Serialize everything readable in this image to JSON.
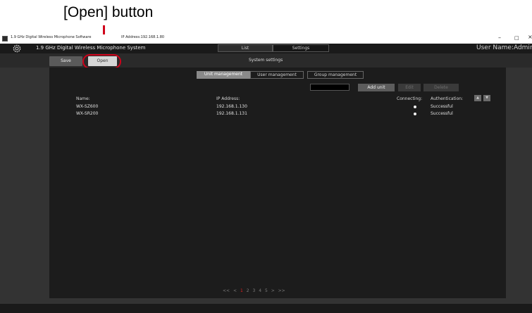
{
  "annotation": {
    "label": "[Open] button"
  },
  "window": {
    "title": "1.9 GHz Digital Wireless Microphone Software",
    "ip": "IP Address:192.168.1.80",
    "minimize": "–",
    "maximize": "□",
    "close": "×"
  },
  "header": {
    "system_name": "1.9 GHz Digital Wireless Microphone System",
    "tabs": [
      "List",
      "Settings"
    ],
    "user": "User Name:Admin"
  },
  "toolbar": {
    "save_label": "Save",
    "open_label": "Open",
    "page_title": "System settings"
  },
  "subtabs": [
    "Unit management",
    "User management",
    "Group management"
  ],
  "actions": {
    "search_value": "",
    "add_unit": "Add unit",
    "edit": "Edit",
    "delete": "Delete"
  },
  "table": {
    "headers": {
      "name": "Name:",
      "ip": "IP Address:",
      "connecting": "Connecting:",
      "authentication": "Authentication:"
    },
    "sort_up": "▲",
    "sort_down": "▼",
    "rows": [
      {
        "name": "WX-SZ600",
        "ip": "192.168.1.130",
        "auth": "Successful"
      },
      {
        "name": "WX-SR200",
        "ip": "192.168.1.131",
        "auth": "Successful"
      }
    ]
  },
  "pagination": {
    "first": "<<",
    "prev": "<",
    "pages": [
      "1",
      "2",
      "3",
      "4",
      "5"
    ],
    "current": "1",
    "next": ">",
    "last": ">>"
  },
  "colors": {
    "highlight": "#d0021b",
    "panel": "#1c1c1c",
    "current_page": "#e02020"
  },
  "icons": [
    "app-icon",
    "gear-icon",
    "sort-up-icon",
    "sort-down-icon"
  ]
}
